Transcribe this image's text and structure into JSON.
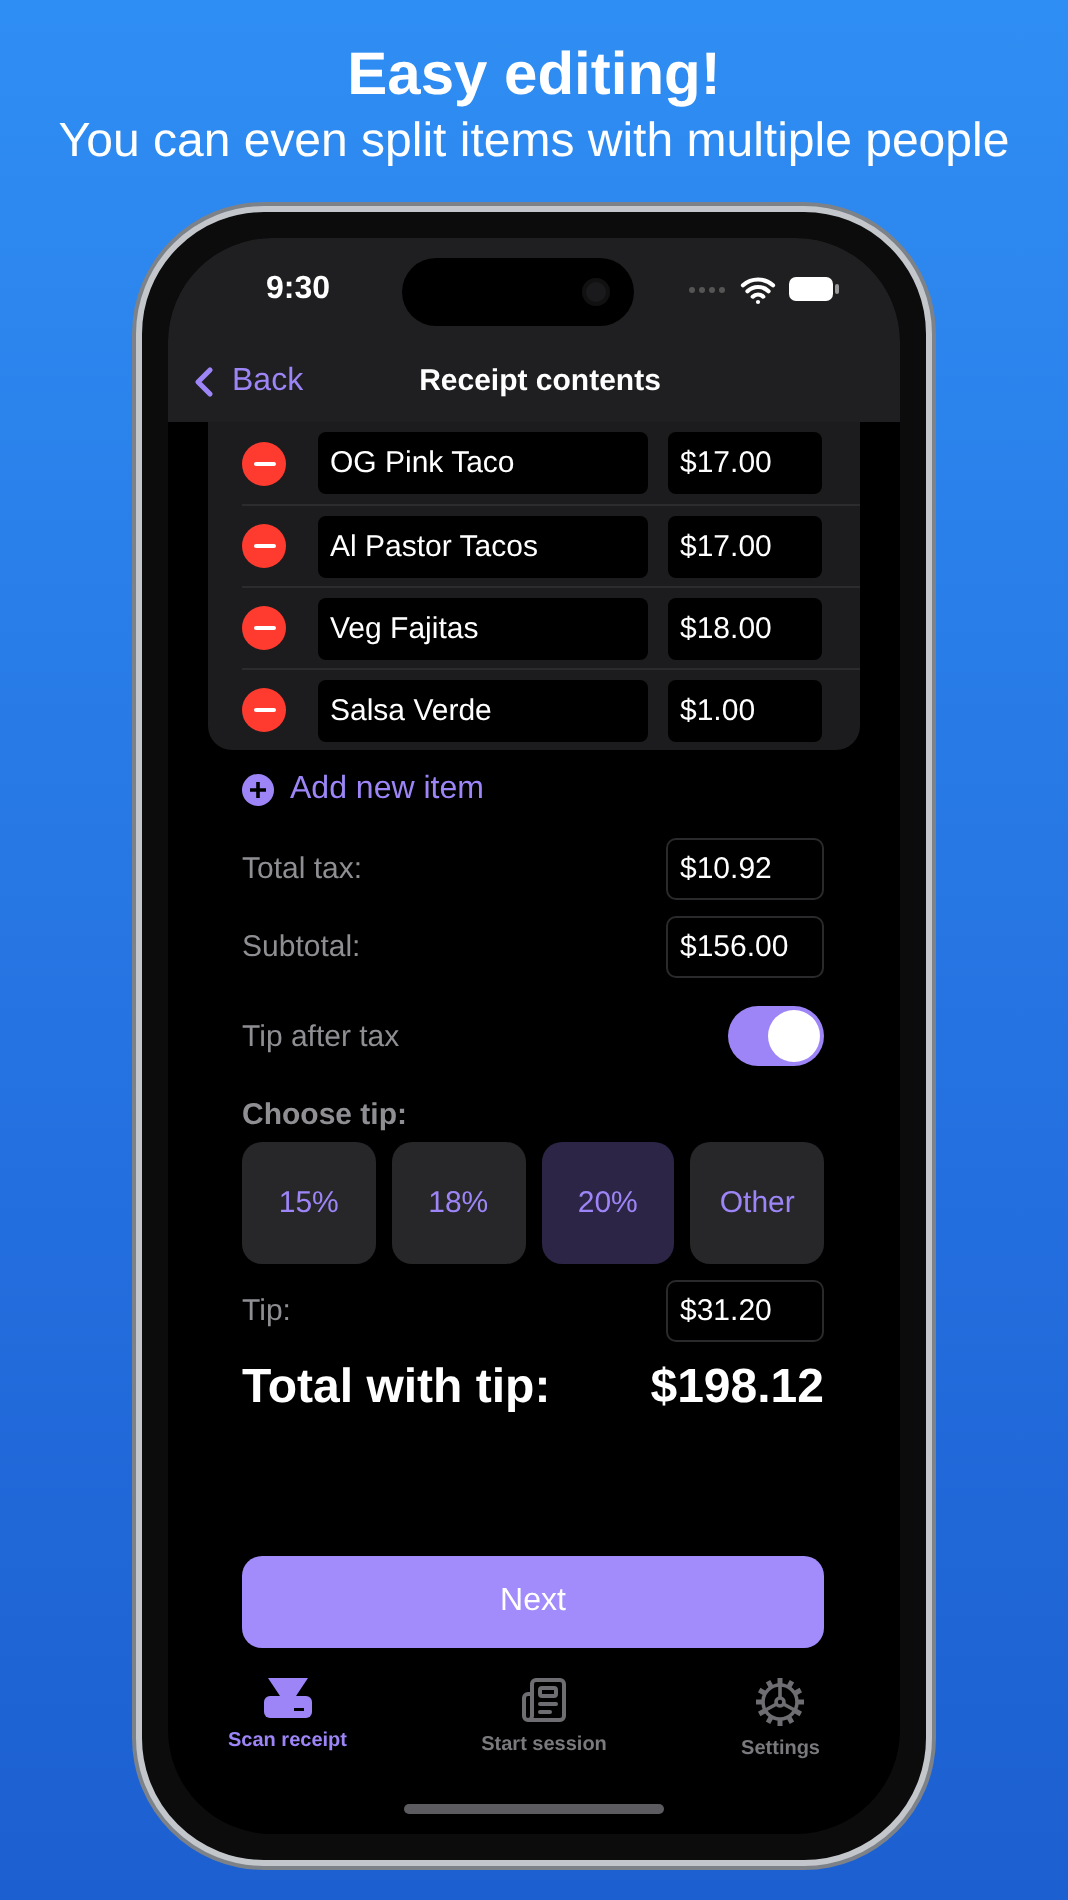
{
  "header": {
    "title": "Easy editing!",
    "subtitle": "You can even split items with multiple people"
  },
  "status_bar": {
    "time": "9:30"
  },
  "nav": {
    "back": "Back",
    "title": "Receipt contents"
  },
  "items": [
    {
      "name": "OG Pink Taco",
      "price": "$17.00"
    },
    {
      "name": "Al Pastor Tacos",
      "price": "$17.00"
    },
    {
      "name": "Veg Fajitas",
      "price": "$18.00"
    },
    {
      "name": "Salsa Verde",
      "price": "$1.00"
    }
  ],
  "add_item": "Add new item",
  "fields": [
    {
      "label": "Total tax:",
      "value": "$10.92"
    },
    {
      "label": "Subtotal:",
      "value": "$156.00"
    }
  ],
  "tip_after_tax": {
    "label": "Tip after tax",
    "on": true
  },
  "choose_tip": {
    "label": "Choose tip:",
    "options": [
      {
        "label": "15%",
        "selected": false
      },
      {
        "label": "18%",
        "selected": false
      },
      {
        "label": "20%",
        "selected": true
      },
      {
        "label": "Other",
        "selected": false
      }
    ]
  },
  "tip": {
    "label": "Tip:",
    "value": "$31.20"
  },
  "total": {
    "label": "Total with tip:",
    "value": "$198.12"
  },
  "next_button": "Next",
  "tabs": [
    {
      "label": "Scan receipt",
      "kind": "scanner",
      "selected": true
    },
    {
      "label": "Start session",
      "kind": "newspaper",
      "selected": false
    },
    {
      "label": "Settings",
      "kind": "gear",
      "selected": false
    }
  ]
}
